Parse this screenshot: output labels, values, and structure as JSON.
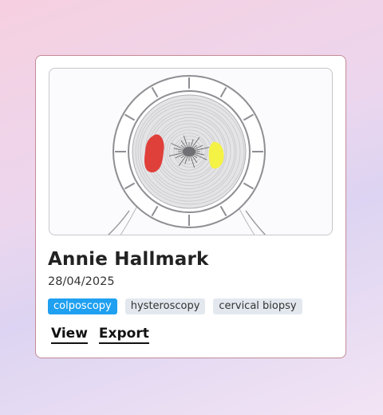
{
  "record": {
    "patient_name": "Annie Hallmark",
    "date": "28/04/2025",
    "image_subject": "colposcopy-cervix-diagram",
    "lesion_colors": [
      "#e0403a",
      "#f4f245"
    ],
    "tags": [
      {
        "label": "colposcopy",
        "color": "#1fa0f0"
      },
      {
        "label": "hysteroscopy",
        "color": "#e3e8ef"
      },
      {
        "label": "cervical biopsy",
        "color": "#e3e8ef"
      }
    ],
    "actions": {
      "view_label": "View",
      "export_label": "Export"
    }
  }
}
